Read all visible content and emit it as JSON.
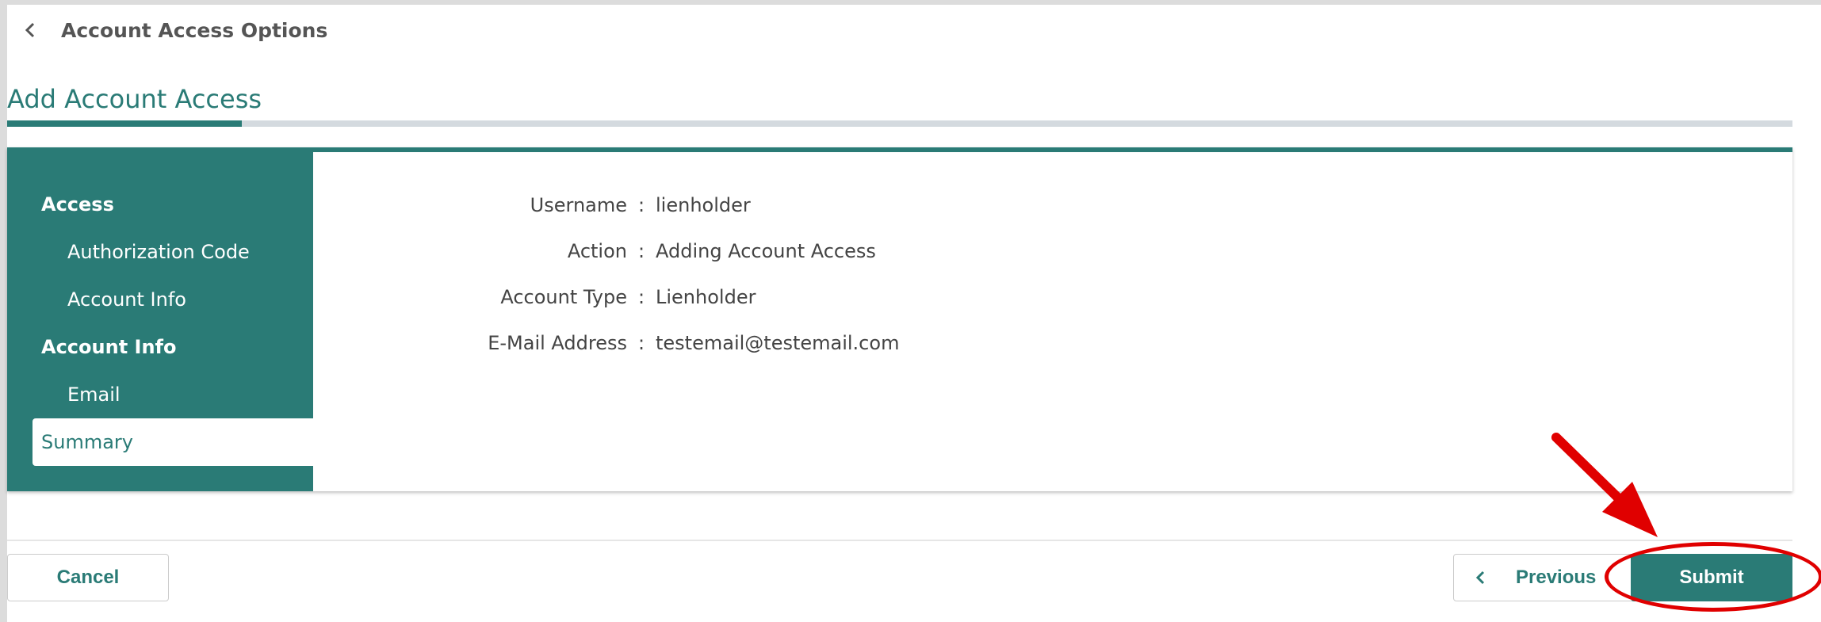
{
  "header": {
    "back_label": "Account Access Options",
    "title": "Add Account Access"
  },
  "sidebar": {
    "sections": [
      {
        "label": "Access",
        "items": [
          "Authorization Code",
          "Account Info"
        ]
      },
      {
        "label": "Account Info",
        "items": [
          "Email",
          "Summary"
        ]
      }
    ],
    "active_item": "Summary"
  },
  "summary": {
    "rows": [
      {
        "key": "Username",
        "value": "lienholder"
      },
      {
        "key": "Action",
        "value": "Adding Account Access"
      },
      {
        "key": "Account Type",
        "value": "Lienholder"
      },
      {
        "key": "E-Mail Address",
        "value": "testemail@testemail.com"
      }
    ],
    "separator": ":"
  },
  "footer": {
    "cancel_label": "Cancel",
    "previous_label": "Previous",
    "submit_label": "Submit"
  },
  "icons": {
    "back": "chevron-left-icon",
    "previous": "chevron-left-icon",
    "annotation_arrow": "red-arrow-icon",
    "annotation_highlight": "red-ellipse-highlight"
  },
  "colors": {
    "accent": "#2a7b76",
    "annotation": "#e00000",
    "text": "#444444",
    "background": "#dcdcdc"
  }
}
